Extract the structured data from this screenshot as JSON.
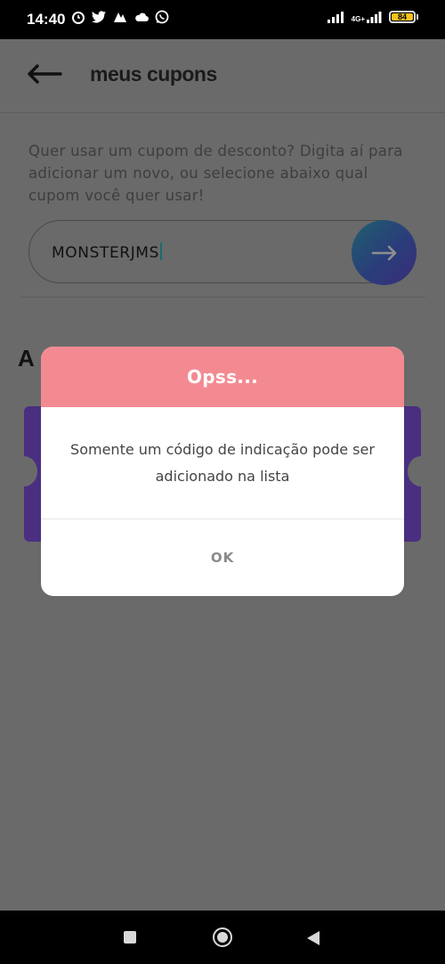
{
  "status_bar": {
    "time": "14:40",
    "network_label": "4G+",
    "battery_level": "84"
  },
  "header": {
    "title": "meus cupons"
  },
  "coupon": {
    "intro_text": "Quer usar um cupom de desconto? Digita aí para adicionar um novo, ou selecione abaixo qual cupom você quer usar!",
    "input_value": "MONSTERJMS"
  },
  "section": {
    "title_visible": "A"
  },
  "dialog": {
    "title": "Opss...",
    "message": "Somente um código de indicação pode ser adicionado na lista",
    "ok_label": "OK"
  },
  "colors": {
    "dialog_header": "#f38a92",
    "ticket": "#4a2f80",
    "submit_gradient_start": "#1f5f6e",
    "submit_gradient_end": "#3a2d78"
  }
}
